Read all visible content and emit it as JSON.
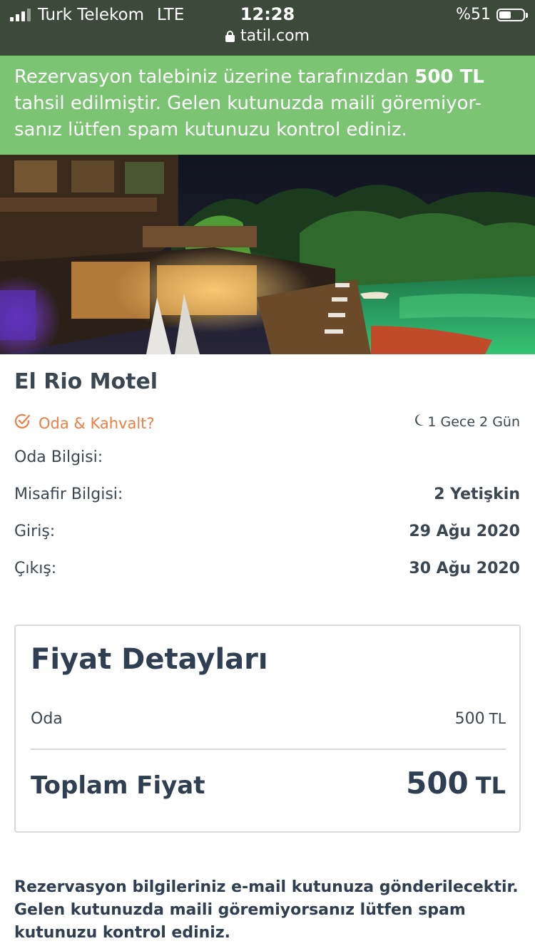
{
  "status_bar": {
    "carrier": "Turk Telekom",
    "network": "LTE",
    "time": "12:28",
    "battery": "%51",
    "battery_level": 0.51
  },
  "browser": {
    "url": "tatil.com"
  },
  "notice": {
    "text_before": "Rezervasyon talebiniz üzerine tarafınızdan ",
    "amount": "500 TL",
    "text_after": " tahsil edilmiştir. Gelen kutunuzda maili göremiyor-sanız lütfen spam kutunuzu kontrol ediniz.",
    "background": "#7cc474"
  },
  "hotel": {
    "name": "El Rio Motel",
    "board_type": "Oda & Kahvalt?",
    "board_icon": "check-circle-icon",
    "duration": "1 Gece 2 Gün",
    "duration_icon": "moon-icon",
    "accent_color": "#ef7d45"
  },
  "details": [
    {
      "label": "Oda Bilgisi:",
      "value": ""
    },
    {
      "label": "Misafir Bilgisi:",
      "value": "2 Yetişkin"
    },
    {
      "label": "Giriş:",
      "value": "29 Ağu 2020"
    },
    {
      "label": "Çıkış:",
      "value": "30 Ağu 2020"
    }
  ],
  "price": {
    "title": "Fiyat Detayları",
    "room_label": "Oda",
    "room_amount": "500",
    "room_currency": "TL",
    "total_label": "Toplam Fiyat",
    "total_amount": "500",
    "total_currency": "TL"
  },
  "footer": {
    "note": "Rezervasyon bilgileriniz e-mail kutunuza gönderilecektir. Gelen kutunuzda maili göremiyorsanız lütfen spam kutunuzu kontrol ediniz."
  }
}
